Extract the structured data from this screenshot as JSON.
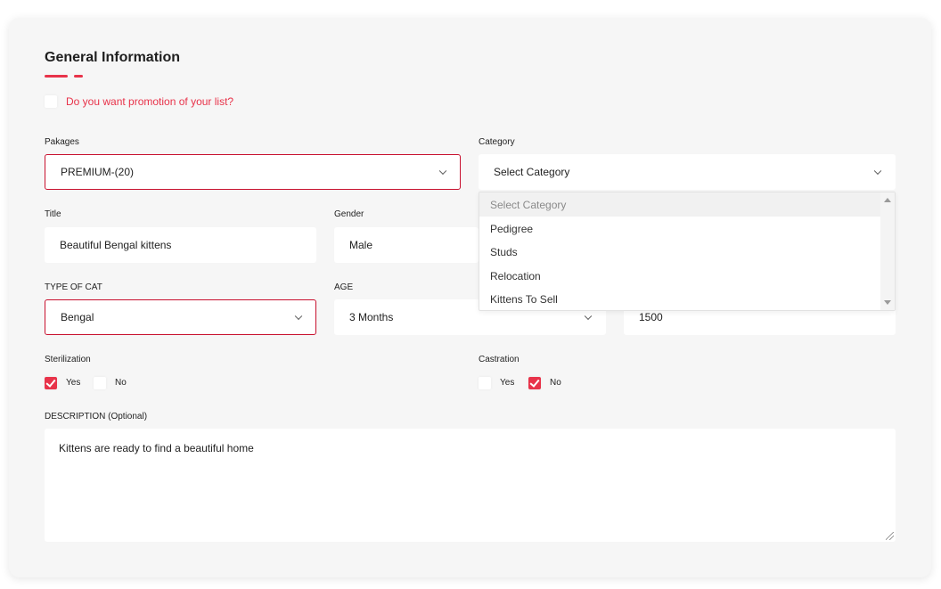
{
  "form": {
    "title": "General Information",
    "promotion_question": "Do you want promotion of your list?",
    "packages": {
      "label": "Pakages",
      "value": "PREMIUM-(20)"
    },
    "category": {
      "label": "Category",
      "value": "Select Category",
      "options": [
        "Select Category",
        "Pedigree",
        "Studs",
        "Relocation",
        "Kittens To Sell"
      ]
    },
    "title_field": {
      "label": "Title",
      "value": "Beautiful Bengal kittens"
    },
    "gender": {
      "label": "Gender",
      "value": "Male"
    },
    "type_of_cat": {
      "label": "TYPE OF CAT",
      "value": "Bengal"
    },
    "age": {
      "label": "AGE",
      "value": "3 Months"
    },
    "price": {
      "value": "1500"
    },
    "sterilization": {
      "label": "Sterilization",
      "yes": "Yes",
      "no": "No",
      "selected": "Yes"
    },
    "castration": {
      "label": "Castration",
      "yes": "Yes",
      "no": "No",
      "selected": "No"
    },
    "description": {
      "label": "DESCRIPTION (Optional)",
      "value": "Kittens are ready to find a beautiful home"
    }
  },
  "colors": {
    "accent": "#e8334a",
    "active_border": "#c8102e",
    "card_bg": "#f6f6f6"
  }
}
